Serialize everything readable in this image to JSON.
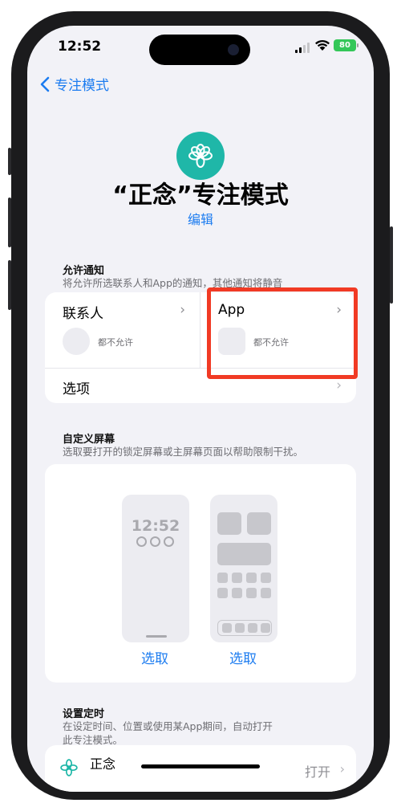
{
  "status_bar": {
    "time": "12:52",
    "battery": "80"
  },
  "nav": {
    "back_label": "专注模式"
  },
  "focus": {
    "title": "“正念”专注模式",
    "edit_label": "编辑"
  },
  "allow_notifications": {
    "title": "允许通知",
    "subtitle": "将允许所选联系人和App的通知，其他通知将静音",
    "people": {
      "label": "联系人",
      "status": "都不允许"
    },
    "apps": {
      "label": "App",
      "status": "都不允许"
    },
    "options_label": "选项"
  },
  "custom_screens": {
    "title": "自定义屏幕",
    "subtitle": "选取要打开的锁定屏幕或主屏幕页面以帮助限制干扰。",
    "lock_time": "12:52",
    "lock_pick": "选取",
    "home_pick": "选取"
  },
  "schedule": {
    "title": "设置定时",
    "subtitle_line1": "在设定时间、位置或使用某App期间，自动打开",
    "subtitle_line2": "此专注模式。",
    "item_name": "正念",
    "item_status": "打开"
  },
  "colors": {
    "accent": "#1c7cf0",
    "focus_icon": "#1fb7a8",
    "highlight": "#f13a24",
    "battery": "#34c759"
  },
  "icons": {
    "back": "chevron-left-icon",
    "focus": "flower-icon",
    "chevron": "chevron-right-icon"
  }
}
